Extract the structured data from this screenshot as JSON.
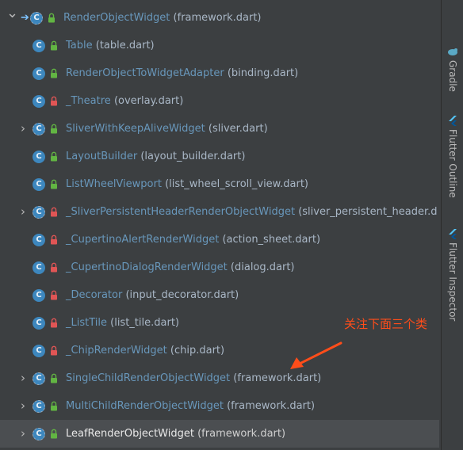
{
  "tree": [
    {
      "name": "RenderObjectWidget",
      "file": "(framework.dart)",
      "expandable": true,
      "expanded": true,
      "visibility": "public",
      "indent": 0,
      "has_nav_arrow": true
    },
    {
      "name": "Table",
      "file": "(table.dart)",
      "expandable": false,
      "visibility": "public",
      "indent": 1
    },
    {
      "name": "RenderObjectToWidgetAdapter",
      "file": "(binding.dart)",
      "expandable": false,
      "visibility": "public",
      "indent": 1
    },
    {
      "name": "_Theatre",
      "file": "(overlay.dart)",
      "expandable": false,
      "visibility": "private",
      "indent": 1
    },
    {
      "name": "SliverWithKeepAliveWidget",
      "file": "(sliver.dart)",
      "expandable": true,
      "visibility": "public",
      "indent": 1
    },
    {
      "name": "LayoutBuilder",
      "file": "(layout_builder.dart)",
      "expandable": false,
      "visibility": "public",
      "indent": 1
    },
    {
      "name": "ListWheelViewport",
      "file": "(list_wheel_scroll_view.dart)",
      "expandable": false,
      "visibility": "public",
      "indent": 1
    },
    {
      "name": "_SliverPersistentHeaderRenderObjectWidget",
      "file": "(sliver_persistent_header.d",
      "expandable": true,
      "visibility": "private",
      "indent": 1
    },
    {
      "name": "_CupertinoAlertRenderWidget",
      "file": "(action_sheet.dart)",
      "expandable": false,
      "visibility": "private",
      "indent": 1
    },
    {
      "name": "_CupertinoDialogRenderWidget",
      "file": "(dialog.dart)",
      "expandable": false,
      "visibility": "private",
      "indent": 1
    },
    {
      "name": "_Decorator",
      "file": "(input_decorator.dart)",
      "expandable": false,
      "visibility": "private",
      "indent": 1
    },
    {
      "name": "_ListTile",
      "file": "(list_tile.dart)",
      "expandable": false,
      "visibility": "private",
      "indent": 1
    },
    {
      "name": "_ChipRenderWidget",
      "file": "(chip.dart)",
      "expandable": false,
      "visibility": "private",
      "indent": 1
    },
    {
      "name": "SingleChildRenderObjectWidget",
      "file": "(framework.dart)",
      "expandable": true,
      "visibility": "public",
      "indent": 1
    },
    {
      "name": "MultiChildRenderObjectWidget",
      "file": "(framework.dart)",
      "expandable": true,
      "visibility": "public",
      "indent": 1
    },
    {
      "name": "LeafRenderObjectWidget",
      "file": "(framework.dart)",
      "expandable": true,
      "visibility": "public",
      "indent": 1,
      "selected": true
    }
  ],
  "sidebar_tabs": [
    {
      "label": "Gradle",
      "icon": "gradle-icon"
    },
    {
      "label": "Flutter Outline",
      "icon": "flutter-outline-icon"
    },
    {
      "label": "Flutter Inspector",
      "icon": "flutter-inspector-icon"
    }
  ],
  "annotation": {
    "text": "关注下面三个类",
    "color": "#ff4d1a"
  },
  "colors": {
    "background": "#3c3f41",
    "class_icon": "#3d87be",
    "name": "#6897bb",
    "file": "#a9b7c6",
    "public_lock": "#62b543",
    "private_lock": "#e05555"
  }
}
